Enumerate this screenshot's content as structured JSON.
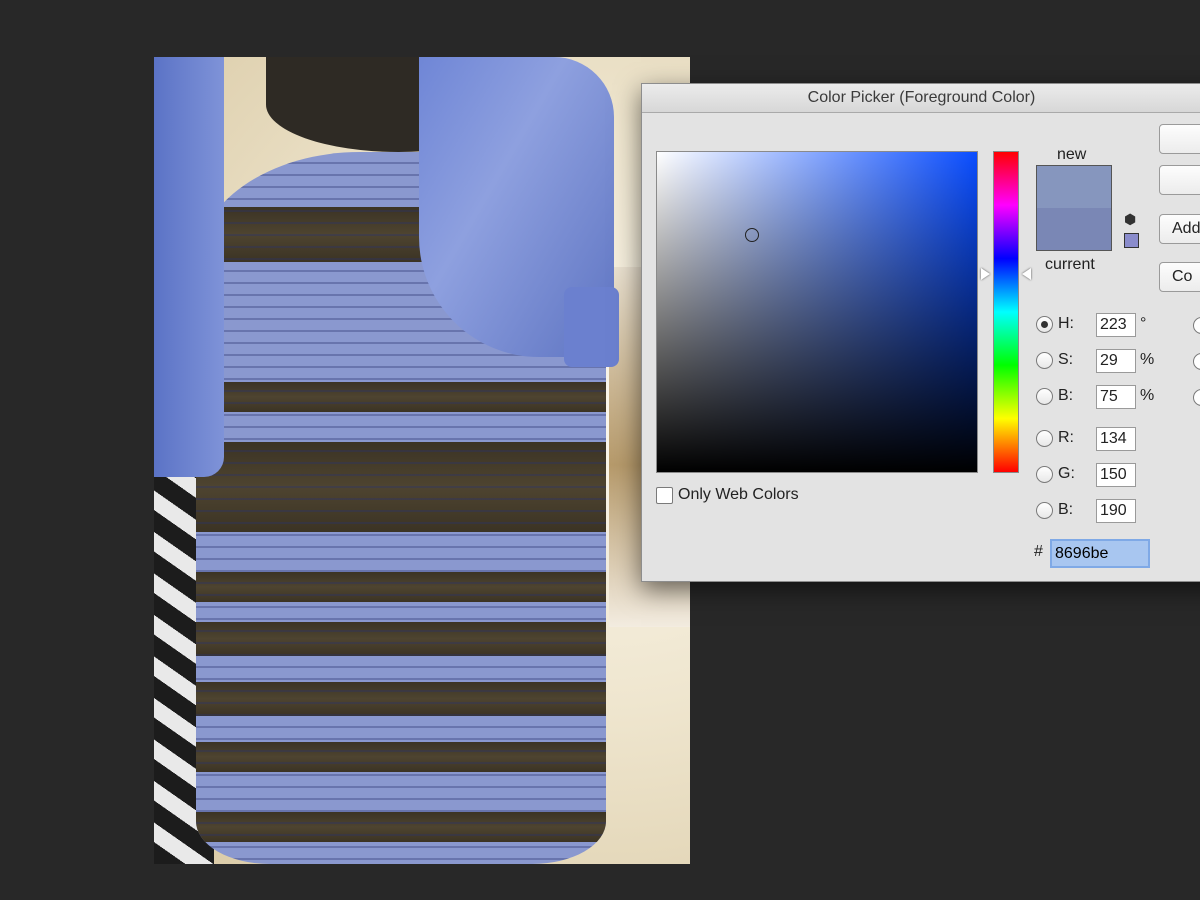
{
  "dialog": {
    "title": "Color Picker (Foreground Color)",
    "buttons": [
      "",
      "",
      "Add",
      "Co"
    ],
    "swatch": {
      "new_label": "new",
      "current_label": "current",
      "new_color": "#8696be",
      "current_color": "#7a87b5"
    },
    "hsb": [
      {
        "label": "H:",
        "value": "223",
        "unit": "°",
        "selected": true
      },
      {
        "label": "S:",
        "value": "29",
        "unit": "%",
        "selected": false
      },
      {
        "label": "B:",
        "value": "75",
        "unit": "%",
        "selected": false
      }
    ],
    "rgb": [
      {
        "label": "R:",
        "value": "134"
      },
      {
        "label": "G:",
        "value": "150"
      },
      {
        "label": "B:",
        "value": "190"
      }
    ],
    "hex": {
      "hash": "#",
      "value": "8696be"
    },
    "only_web_colors": {
      "label": "Only Web Colors",
      "checked": false
    }
  },
  "colors": {
    "field_hue": "#0a4dff",
    "dialog_bg": "#e3e3e3",
    "hex_focus": "#7fa9e6"
  }
}
